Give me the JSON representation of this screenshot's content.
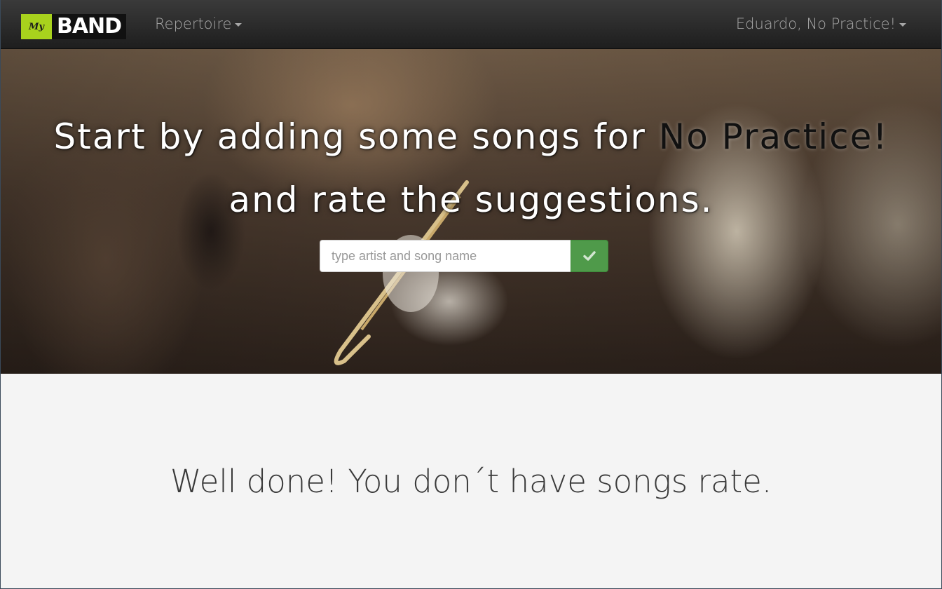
{
  "brand": {
    "prefix": "My",
    "name": "BAND"
  },
  "nav": {
    "repertoire_label": "Repertoire",
    "user_label": "Eduardo, No Practice!"
  },
  "hero": {
    "line1_text": "Start by adding some songs for ",
    "band_name": "No Practice!",
    "line2_text": "and rate the suggestions."
  },
  "search": {
    "placeholder": "type artist and song name",
    "value": "",
    "submit_icon": "check-icon"
  },
  "main": {
    "message": "Well done! You don´t have songs rate."
  },
  "colors": {
    "navbar": "#1e1e1e",
    "brand_accent": "#a8d21d",
    "submit_button": "#4f9a4a",
    "page_background": "#f4f4f4"
  }
}
